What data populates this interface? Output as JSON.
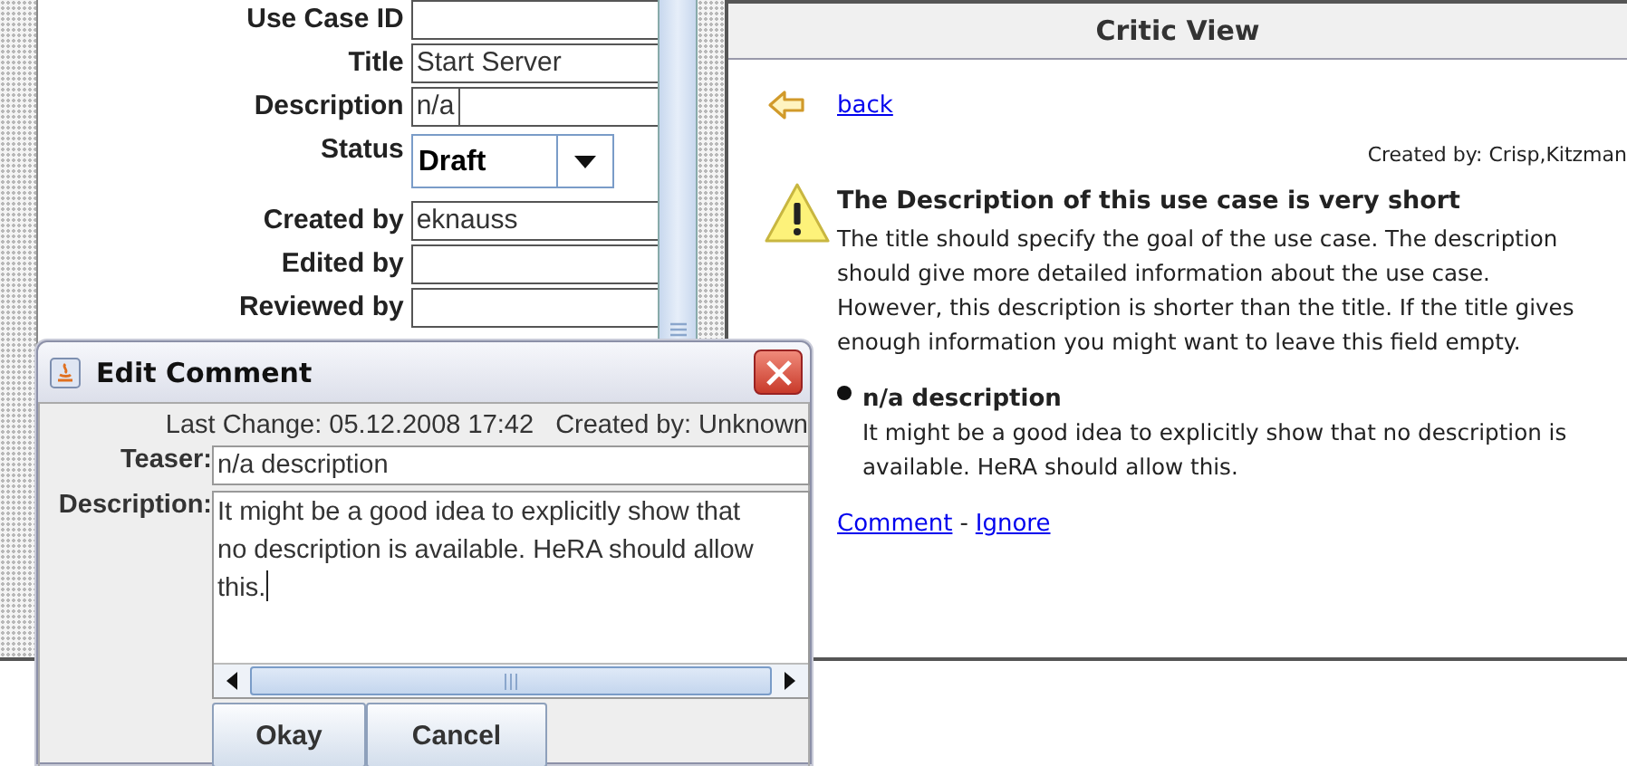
{
  "form": {
    "fields": [
      {
        "label": "Use Case ID",
        "kind": "text"
      },
      {
        "label": "Title",
        "kind": "text",
        "value": "Start Server"
      },
      {
        "label": "Description",
        "kind": "short",
        "value": "n/a"
      },
      {
        "label": "Status",
        "kind": "dropdown",
        "value": "Draft"
      },
      {
        "label": "Created by",
        "kind": "text",
        "value": "eknauss"
      },
      {
        "label": "Edited by",
        "kind": "text"
      },
      {
        "label": "Reviewed by",
        "kind": "text"
      }
    ]
  },
  "critic_view": {
    "title": "Critic View",
    "back_link": "back",
    "created_by": "Created by: Crisp,Kitzman",
    "warning": {
      "title": "The Description of this use case is very short",
      "text": "The title should specify the goal of the use case. The description should give more detailed information about the use case. However, this description is shorter than the title. If the title gives enough information you might want to leave this field empty."
    },
    "comments": [
      {
        "title": "n/a description",
        "text": "It might be a good idea to explicitly show that no description is available. HeRA should allow this."
      }
    ],
    "actions": [
      "Comment",
      "Ignore"
    ],
    "action_separator": "-"
  },
  "dialog": {
    "title": "Edit Comment",
    "last_change": "Last Change: 05.12.2008 17:42",
    "created_by": "Created by: Unknown",
    "teaser_label": "Teaser:",
    "teaser": "n/a description",
    "description_label": "Description:",
    "description": "It might be a good idea to explicitly show that no description is available. HeRA should allow this.",
    "buttons": [
      "Okay",
      "Cancel"
    ]
  }
}
